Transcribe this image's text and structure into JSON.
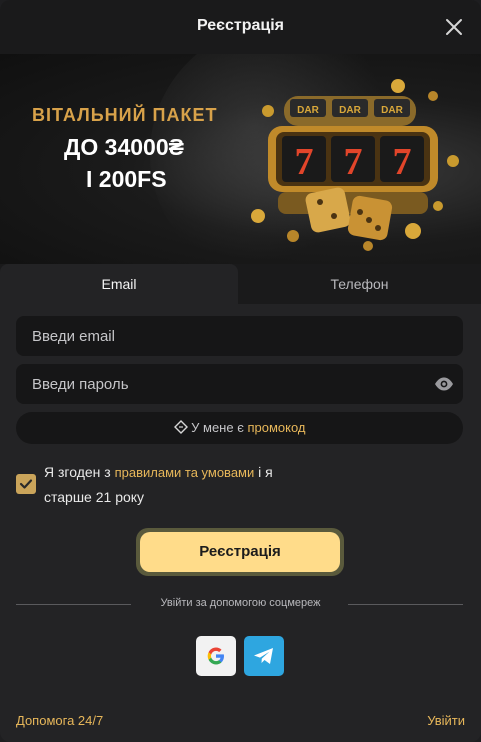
{
  "header": {
    "title": "Реєстрація"
  },
  "banner": {
    "line1": "ВІТАЛЬНИЙ ПАКЕТ",
    "line2": "ДО 34000₴",
    "line3": "І 200FS",
    "slot_text": "DAR"
  },
  "tabs": [
    {
      "label": "Email"
    },
    {
      "label": "Телефон"
    }
  ],
  "form": {
    "email_placeholder": "Введи email",
    "password_placeholder": "Введи пароль",
    "promo_prefix": "У мене є ",
    "promo_link": "промокод",
    "agree_prefix": "Я згоден з ",
    "agree_link": "правилами та умовами",
    "agree_suffix": " і я старше 21 року",
    "submit_label": "Реєстрація"
  },
  "social": {
    "divider_text": "Увійти за допомогою соцмереж",
    "google_letter": "G"
  },
  "footer": {
    "help": "Допомога 24/7",
    "login": "Увійти"
  },
  "colors": {
    "accent": "#e7b75a",
    "button": "#ffdc8a",
    "telegram": "#2ea6e0"
  }
}
